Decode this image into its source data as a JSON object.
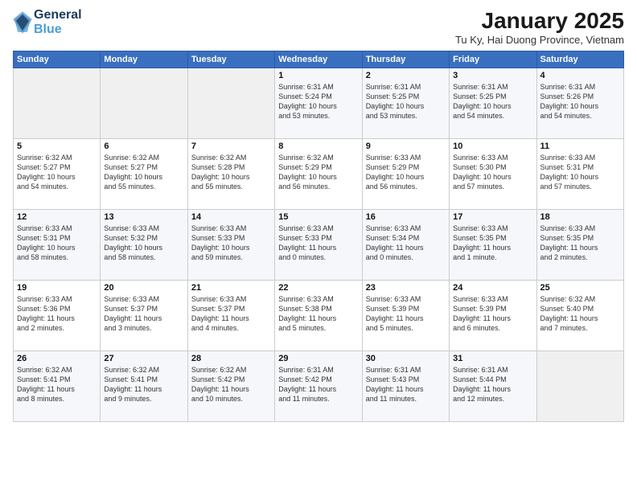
{
  "header": {
    "logo_line1": "General",
    "logo_line2": "Blue",
    "month": "January 2025",
    "location": "Tu Ky, Hai Duong Province, Vietnam"
  },
  "days_of_week": [
    "Sunday",
    "Monday",
    "Tuesday",
    "Wednesday",
    "Thursday",
    "Friday",
    "Saturday"
  ],
  "weeks": [
    [
      {
        "num": "",
        "info": ""
      },
      {
        "num": "",
        "info": ""
      },
      {
        "num": "",
        "info": ""
      },
      {
        "num": "1",
        "info": "Sunrise: 6:31 AM\nSunset: 5:24 PM\nDaylight: 10 hours\nand 53 minutes."
      },
      {
        "num": "2",
        "info": "Sunrise: 6:31 AM\nSunset: 5:25 PM\nDaylight: 10 hours\nand 53 minutes."
      },
      {
        "num": "3",
        "info": "Sunrise: 6:31 AM\nSunset: 5:25 PM\nDaylight: 10 hours\nand 54 minutes."
      },
      {
        "num": "4",
        "info": "Sunrise: 6:31 AM\nSunset: 5:26 PM\nDaylight: 10 hours\nand 54 minutes."
      }
    ],
    [
      {
        "num": "5",
        "info": "Sunrise: 6:32 AM\nSunset: 5:27 PM\nDaylight: 10 hours\nand 54 minutes."
      },
      {
        "num": "6",
        "info": "Sunrise: 6:32 AM\nSunset: 5:27 PM\nDaylight: 10 hours\nand 55 minutes."
      },
      {
        "num": "7",
        "info": "Sunrise: 6:32 AM\nSunset: 5:28 PM\nDaylight: 10 hours\nand 55 minutes."
      },
      {
        "num": "8",
        "info": "Sunrise: 6:32 AM\nSunset: 5:29 PM\nDaylight: 10 hours\nand 56 minutes."
      },
      {
        "num": "9",
        "info": "Sunrise: 6:33 AM\nSunset: 5:29 PM\nDaylight: 10 hours\nand 56 minutes."
      },
      {
        "num": "10",
        "info": "Sunrise: 6:33 AM\nSunset: 5:30 PM\nDaylight: 10 hours\nand 57 minutes."
      },
      {
        "num": "11",
        "info": "Sunrise: 6:33 AM\nSunset: 5:31 PM\nDaylight: 10 hours\nand 57 minutes."
      }
    ],
    [
      {
        "num": "12",
        "info": "Sunrise: 6:33 AM\nSunset: 5:31 PM\nDaylight: 10 hours\nand 58 minutes."
      },
      {
        "num": "13",
        "info": "Sunrise: 6:33 AM\nSunset: 5:32 PM\nDaylight: 10 hours\nand 58 minutes."
      },
      {
        "num": "14",
        "info": "Sunrise: 6:33 AM\nSunset: 5:33 PM\nDaylight: 10 hours\nand 59 minutes."
      },
      {
        "num": "15",
        "info": "Sunrise: 6:33 AM\nSunset: 5:33 PM\nDaylight: 11 hours\nand 0 minutes."
      },
      {
        "num": "16",
        "info": "Sunrise: 6:33 AM\nSunset: 5:34 PM\nDaylight: 11 hours\nand 0 minutes."
      },
      {
        "num": "17",
        "info": "Sunrise: 6:33 AM\nSunset: 5:35 PM\nDaylight: 11 hours\nand 1 minute."
      },
      {
        "num": "18",
        "info": "Sunrise: 6:33 AM\nSunset: 5:35 PM\nDaylight: 11 hours\nand 2 minutes."
      }
    ],
    [
      {
        "num": "19",
        "info": "Sunrise: 6:33 AM\nSunset: 5:36 PM\nDaylight: 11 hours\nand 2 minutes."
      },
      {
        "num": "20",
        "info": "Sunrise: 6:33 AM\nSunset: 5:37 PM\nDaylight: 11 hours\nand 3 minutes."
      },
      {
        "num": "21",
        "info": "Sunrise: 6:33 AM\nSunset: 5:37 PM\nDaylight: 11 hours\nand 4 minutes."
      },
      {
        "num": "22",
        "info": "Sunrise: 6:33 AM\nSunset: 5:38 PM\nDaylight: 11 hours\nand 5 minutes."
      },
      {
        "num": "23",
        "info": "Sunrise: 6:33 AM\nSunset: 5:39 PM\nDaylight: 11 hours\nand 5 minutes."
      },
      {
        "num": "24",
        "info": "Sunrise: 6:33 AM\nSunset: 5:39 PM\nDaylight: 11 hours\nand 6 minutes."
      },
      {
        "num": "25",
        "info": "Sunrise: 6:32 AM\nSunset: 5:40 PM\nDaylight: 11 hours\nand 7 minutes."
      }
    ],
    [
      {
        "num": "26",
        "info": "Sunrise: 6:32 AM\nSunset: 5:41 PM\nDaylight: 11 hours\nand 8 minutes."
      },
      {
        "num": "27",
        "info": "Sunrise: 6:32 AM\nSunset: 5:41 PM\nDaylight: 11 hours\nand 9 minutes."
      },
      {
        "num": "28",
        "info": "Sunrise: 6:32 AM\nSunset: 5:42 PM\nDaylight: 11 hours\nand 10 minutes."
      },
      {
        "num": "29",
        "info": "Sunrise: 6:31 AM\nSunset: 5:42 PM\nDaylight: 11 hours\nand 11 minutes."
      },
      {
        "num": "30",
        "info": "Sunrise: 6:31 AM\nSunset: 5:43 PM\nDaylight: 11 hours\nand 11 minutes."
      },
      {
        "num": "31",
        "info": "Sunrise: 6:31 AM\nSunset: 5:44 PM\nDaylight: 11 hours\nand 12 minutes."
      },
      {
        "num": "",
        "info": ""
      }
    ]
  ]
}
